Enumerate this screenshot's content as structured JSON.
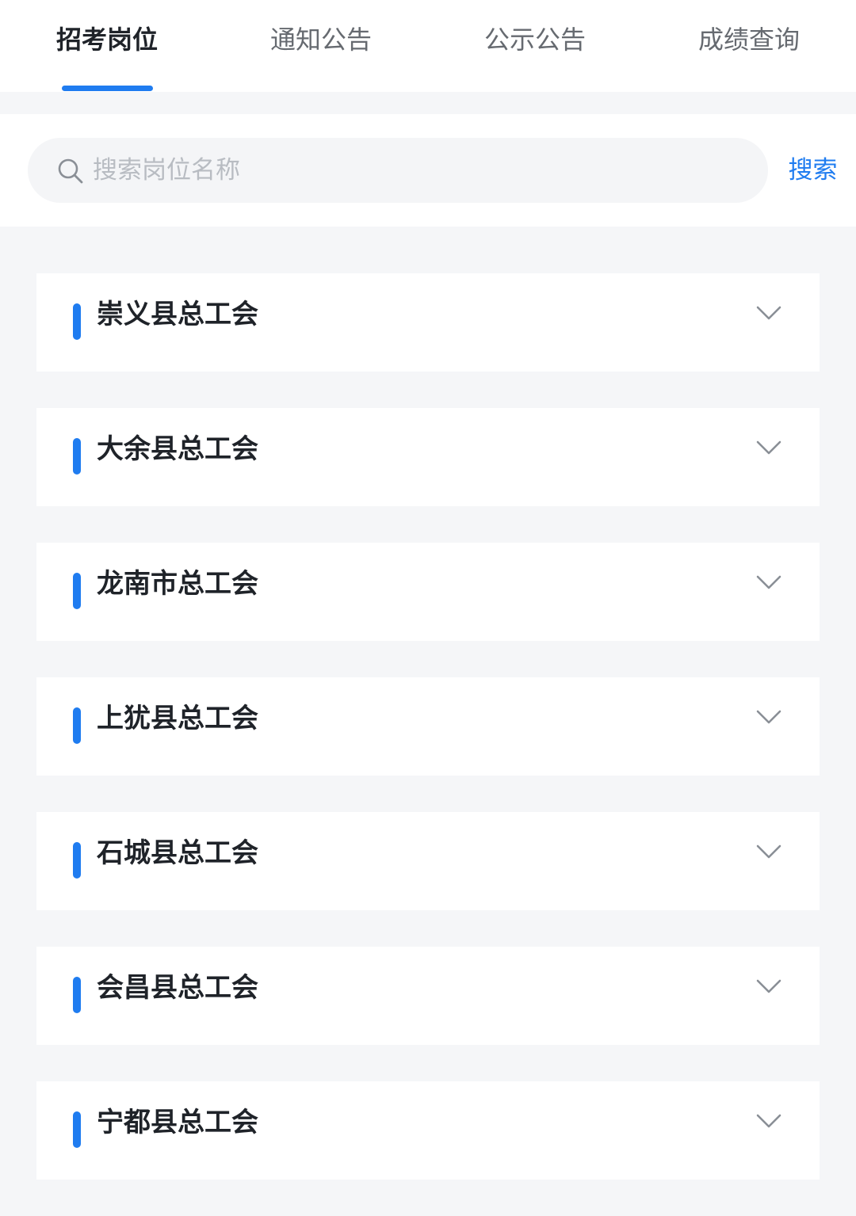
{
  "tabs": [
    {
      "label": "招考岗位",
      "active": true
    },
    {
      "label": "通知公告",
      "active": false
    },
    {
      "label": "公示公告",
      "active": false
    },
    {
      "label": "成绩查询",
      "active": false
    }
  ],
  "search": {
    "placeholder": "搜索岗位名称",
    "value": "",
    "button_label": "搜索"
  },
  "units": [
    {
      "name": "崇义县总工会"
    },
    {
      "name": "大余县总工会"
    },
    {
      "name": "龙南市总工会"
    },
    {
      "name": "上犹县总工会"
    },
    {
      "name": "石城县总工会"
    },
    {
      "name": "会昌县总工会"
    },
    {
      "name": "宁都县总工会"
    }
  ],
  "icons": {
    "search": "search-icon",
    "expand": "chevron-down-icon"
  },
  "colors": {
    "accent": "#1f7cf0",
    "page_background": "#f5f6f8",
    "card_background": "#ffffff",
    "title_text": "#1f2329",
    "inactive_tab_text": "#666a70",
    "placeholder_text": "#b8bcc2"
  }
}
